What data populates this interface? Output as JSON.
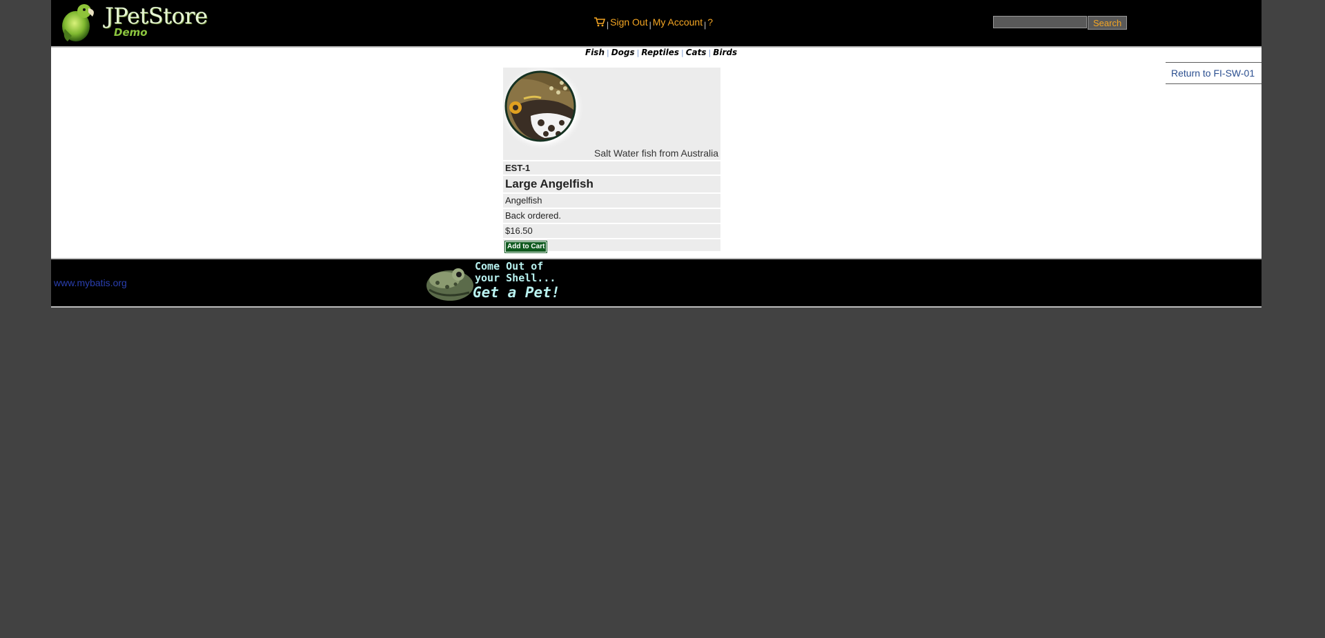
{
  "header": {
    "logo_title": "JPetStore",
    "logo_subtitle": "Demo",
    "menu": {
      "sign_out": "Sign Out",
      "my_account": "My Account",
      "help": "?",
      "separator": "|"
    },
    "search": {
      "value": "",
      "button_label": "Search"
    }
  },
  "quicklinks": [
    "Fish",
    "Dogs",
    "Reptiles",
    "Cats",
    "Birds"
  ],
  "quicklink_separator": "|",
  "back_link": "Return to FI-SW-01",
  "item": {
    "description": "Salt Water fish from Australia",
    "item_id": "EST-1",
    "name": "Large Angelfish",
    "product": "Angelfish",
    "stock": "Back ordered.",
    "price": "$16.50",
    "add_to_cart_label": "Add to Cart"
  },
  "footer": {
    "link": "www.mybatis.org",
    "banner_line1": "Come Out of",
    "banner_line2": "your Shell...",
    "banner_line3": "Get a Pet!"
  },
  "colors": {
    "background": "#424242",
    "header_bg": "#000000",
    "menu_link": "#f5a623",
    "cell_bg": "#ececec",
    "add_to_cart_bg": "#0f5a1f"
  },
  "icons": {
    "logo": "parrot-logo-icon",
    "cart": "cart-icon",
    "item_image": "angelfish-image",
    "banner": "frog-banner-image"
  }
}
